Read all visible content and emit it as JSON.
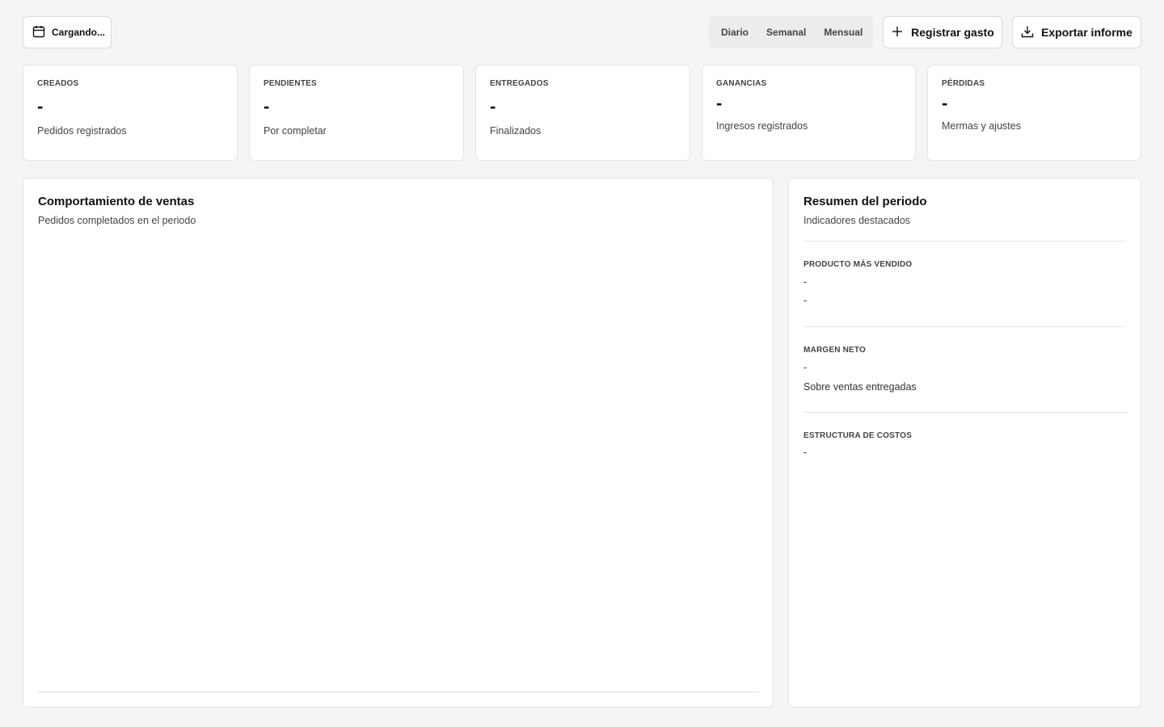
{
  "toolbar": {
    "date_label": "Cargando...",
    "periods": [
      "Diario",
      "Semanal",
      "Mensual"
    ],
    "register_label": "Registrar gasto",
    "export_label": "Exportar informe"
  },
  "kpis": [
    {
      "label": "CREADOS",
      "value": "-",
      "desc": "Pedidos registrados"
    },
    {
      "label": "PENDIENTES",
      "value": "-",
      "desc": "Por completar"
    },
    {
      "label": "ENTREGADOS",
      "value": "-",
      "desc": "Finalizados"
    },
    {
      "label": "GANANCIAS",
      "value": "-",
      "desc": "Ingresos registrados"
    },
    {
      "label": "PÉRDIDAS",
      "value": "-",
      "desc": "Mermas y ajustes"
    }
  ],
  "sales": {
    "title": "Comportamiento de ventas",
    "subtitle": "Pedidos completados en el periodo"
  },
  "summary": {
    "title": "Resumen del periodo",
    "subtitle": "Indicadores destacados",
    "top_product": {
      "label": "PRODUCTO MÁS VENDIDO",
      "line1": "-",
      "line2": "-"
    },
    "net_margin": {
      "label": "MARGEN NETO",
      "value": "-",
      "desc": "Sobre ventas entregadas"
    },
    "cost_structure": {
      "label": "ESTRUCTURA DE COSTOS",
      "value": "-"
    }
  }
}
